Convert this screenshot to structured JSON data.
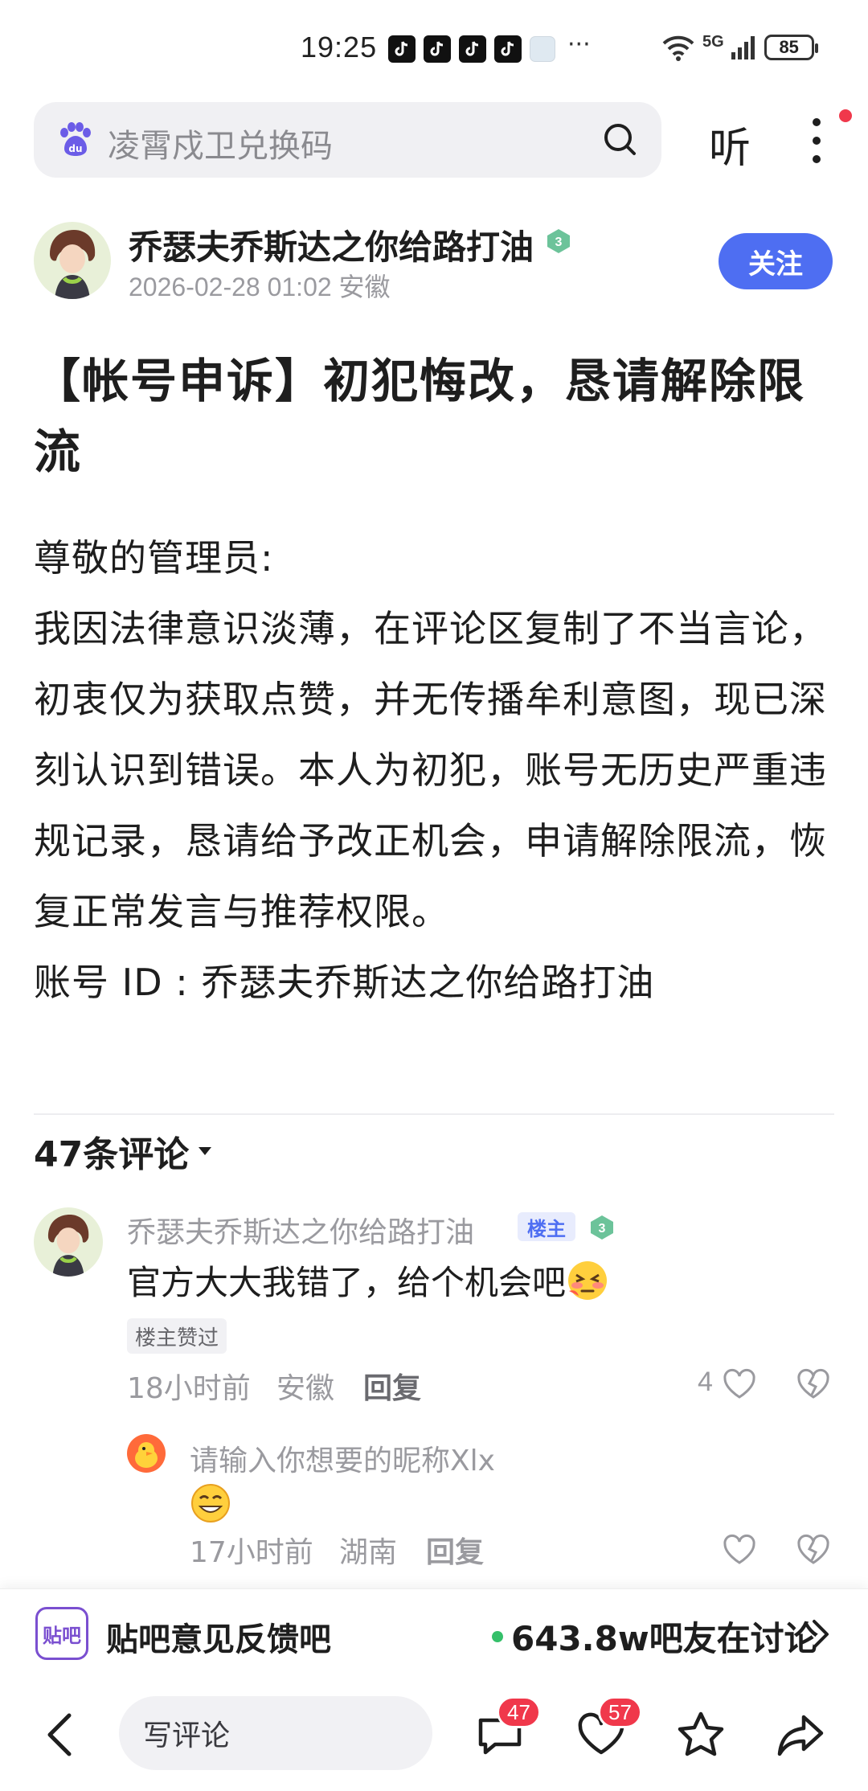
{
  "status_bar": {
    "time": "19:25",
    "dots": "···",
    "network": "5G",
    "battery": "85"
  },
  "search": {
    "query": "凌霄戍卫兑换码",
    "listen_label": "听"
  },
  "post": {
    "author": "乔瑟夫乔斯达之你给路打油",
    "author_level": "3",
    "datetime_location": "2026-02-28 01:02 安徽",
    "follow_label": "关注",
    "title": "【帐号申诉】初犯悔改，恳请解除限流",
    "body": [
      "尊敬的管理员:",
      "我因法律意识淡薄，在评论区复制了不当言论，初衷仅为获取点赞，并无传播牟利意图，现已深刻认识到错误。本人为初犯，账号无历史严重违规记录，恳请给予改正机会，申请解除限流，恢复正常发言与推荐权限。",
      "账号 ID : 乔瑟夫乔斯达之你给路打油"
    ]
  },
  "comments": {
    "count_label": "47条评论",
    "items": [
      {
        "user": "乔瑟夫乔斯达之你给路打油",
        "owner_badge": "楼主",
        "level": "3",
        "text": "官方大大我错了，给个机会吧",
        "liked_badge": "楼主赞过",
        "time": "18小时前",
        "location": "安徽",
        "reply_label": "回复",
        "likes": "4"
      }
    ],
    "sub": {
      "user": "请输入你想要的昵称Xlx",
      "emoji": "smile-emoji",
      "time": "17小时前",
      "location": "湖南",
      "reply_label": "回复"
    }
  },
  "forum": {
    "logo_text": "贴吧",
    "name": "贴吧意见反馈吧",
    "online": "643.8w吧友在讨论"
  },
  "bottom_bar": {
    "write_placeholder": "写评论",
    "comment_badge": "47",
    "like_badge": "57"
  },
  "colors": {
    "accent": "#4e6ef2",
    "badge_red": "#f0384b",
    "level_green": "#5cc08a",
    "meta_gray": "#9a9a9f"
  }
}
